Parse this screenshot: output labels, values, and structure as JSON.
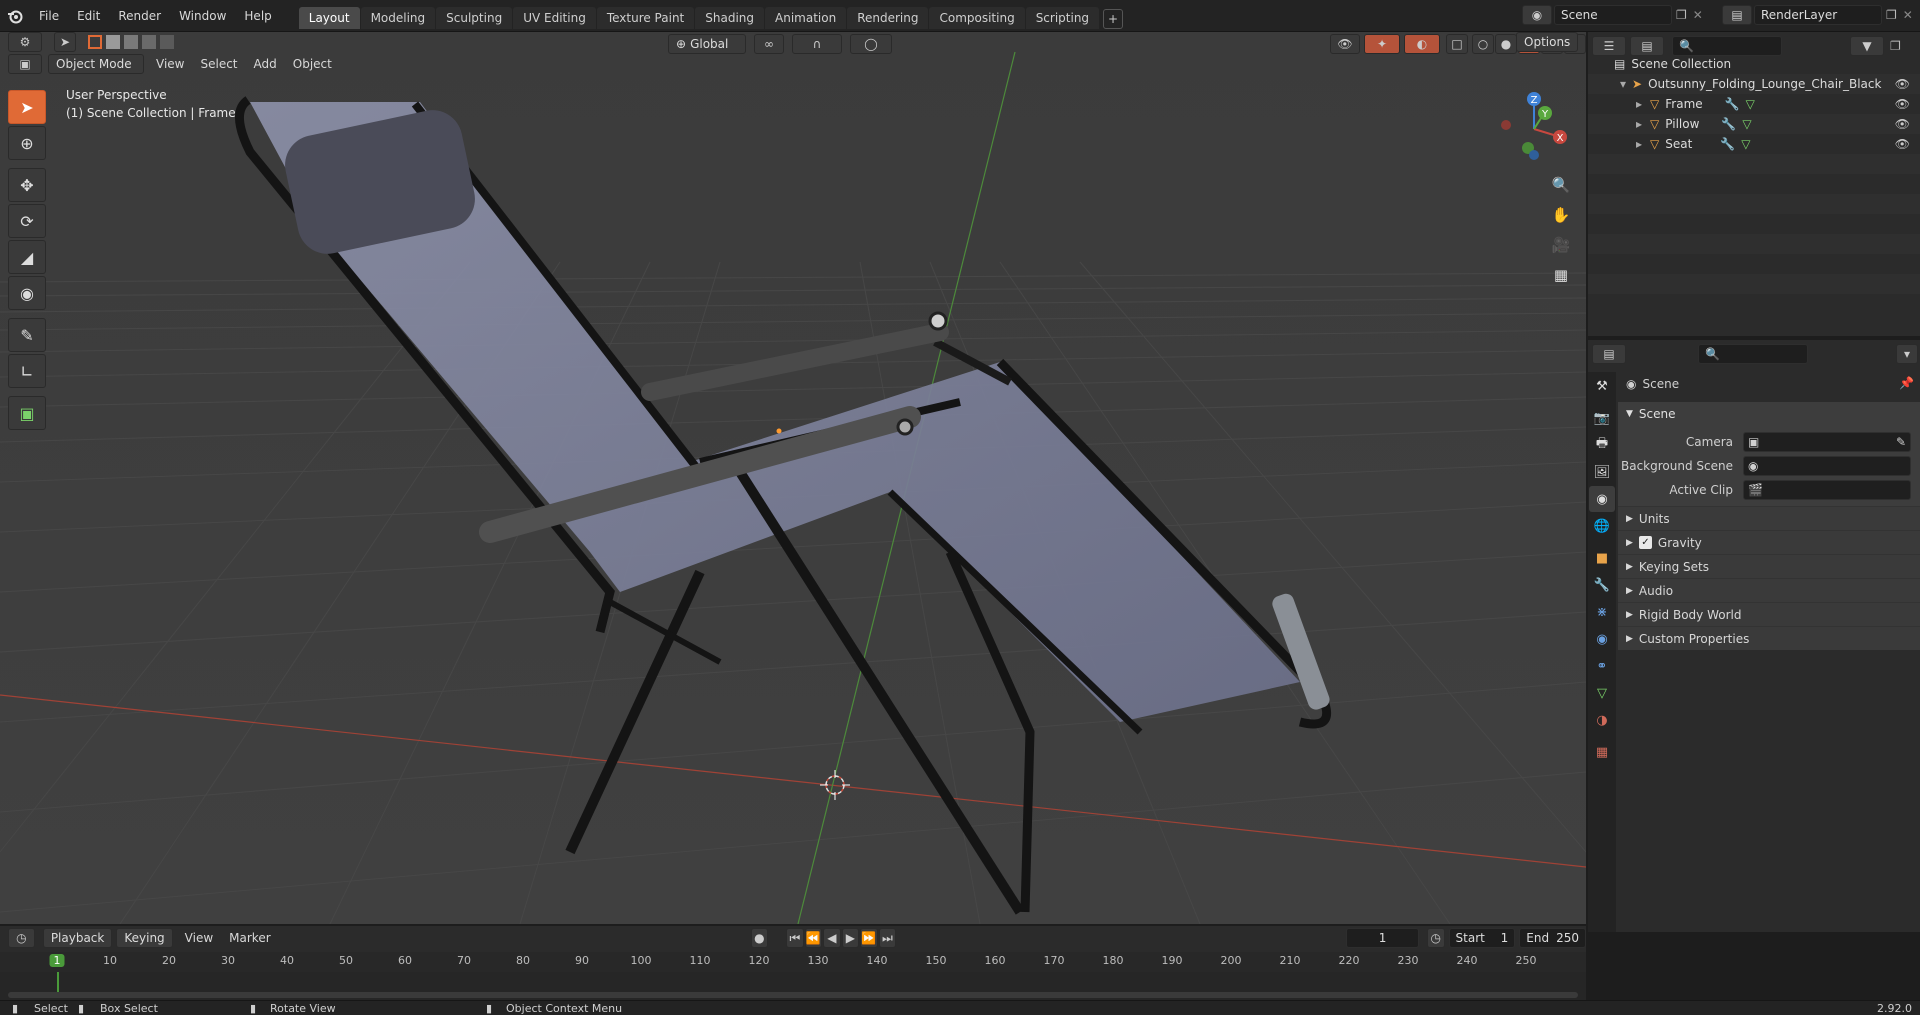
{
  "topbar": {
    "menus": [
      "File",
      "Edit",
      "Render",
      "Window",
      "Help"
    ],
    "workspaces": [
      "Layout",
      "Modeling",
      "Sculpting",
      "UV Editing",
      "Texture Paint",
      "Shading",
      "Animation",
      "Rendering",
      "Compositing",
      "Scripting"
    ],
    "active_workspace": "Layout",
    "add_tab": "+",
    "scene_name": "Scene",
    "view_layer": "RenderLayer"
  },
  "viewport_header": {
    "mode": "Object Mode",
    "menus": [
      "View",
      "Select",
      "Add",
      "Object"
    ],
    "orientation": "Global",
    "options": "Options"
  },
  "viewport": {
    "overlay_line1": "User Perspective",
    "overlay_line2": "(1) Scene Collection | Frame",
    "gizmo_x": "X",
    "gizmo_y": "Y",
    "gizmo_z": "Z"
  },
  "outliner": {
    "root": "Scene Collection",
    "collection": "Outsunny_Folding_Lounge_Chair_Black",
    "objects": [
      "Frame",
      "Pillow",
      "Seat"
    ]
  },
  "properties": {
    "header": "Scene",
    "panel": "Scene",
    "rows": [
      {
        "label": "Camera"
      },
      {
        "label": "Background Scene"
      },
      {
        "label": "Active Clip"
      }
    ],
    "subpanels": [
      "Units",
      "Gravity",
      "Keying Sets",
      "Audio",
      "Rigid Body World",
      "Custom Properties"
    ],
    "gravity_checked": true
  },
  "timeline": {
    "menus": [
      "Playback",
      "Keying",
      "View",
      "Marker"
    ],
    "current_frame": "1",
    "start_label": "Start",
    "start": "1",
    "end_label": "End",
    "end": "250",
    "ticks": [
      "1",
      "10",
      "20",
      "30",
      "40",
      "50",
      "60",
      "70",
      "80",
      "90",
      "100",
      "110",
      "120",
      "130",
      "140",
      "150",
      "160",
      "170",
      "180",
      "190",
      "200",
      "210",
      "220",
      "230",
      "240",
      "250"
    ]
  },
  "statusbar": {
    "select": "Select",
    "box_select": "Box Select",
    "rotate": "Rotate View",
    "context": "Object Context Menu",
    "version": "2.92.0"
  },
  "colors": {
    "accent": "#e06a36",
    "x_axis": "#c8483f",
    "y_axis": "#5aa83e",
    "z_axis": "#3f82d8"
  }
}
